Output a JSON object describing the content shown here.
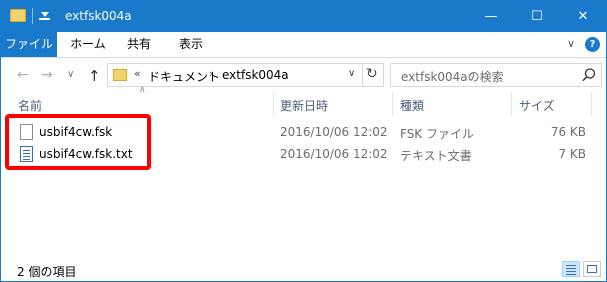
{
  "window": {
    "title": "extfsk004a",
    "minimize_glyph": "—",
    "maximize_glyph": "☐",
    "close_glyph": "✕",
    "titlebar_color": "#1979ca"
  },
  "ribbon": {
    "tabs": [
      {
        "label": "ファイル"
      },
      {
        "label": "ホーム"
      },
      {
        "label": "共有"
      },
      {
        "label": "表示"
      }
    ],
    "expand_glyph": "∨",
    "help_glyph": "?"
  },
  "nav": {
    "back_glyph": "←",
    "forward_glyph": "→",
    "recent_glyph": "∨",
    "up_glyph": "↑",
    "breadcrumb_prefix": "«",
    "breadcrumb": [
      "ドキュメント",
      "extfsk004a"
    ],
    "separator_glyph": "›",
    "dropdown_glyph": "∨",
    "refresh_glyph": "↻",
    "search_placeholder": "extfsk004aの検索"
  },
  "columns": {
    "name": "名前",
    "modified": "更新日時",
    "type": "種類",
    "size": "サイズ",
    "sort_glyph": "∧"
  },
  "files": [
    {
      "name": "usbif4cw.fsk",
      "modified": "2016/10/06 12:02",
      "type": "FSK ファイル",
      "size": "76 KB",
      "icon": "generic-file-icon"
    },
    {
      "name": "usbif4cw.fsk.txt",
      "modified": "2016/10/06 12:02",
      "type": "テキスト文書",
      "size": "7 KB",
      "icon": "text-file-icon"
    }
  ],
  "status": {
    "item_count": "2 個の項目"
  },
  "highlight_color": "#ff0000"
}
